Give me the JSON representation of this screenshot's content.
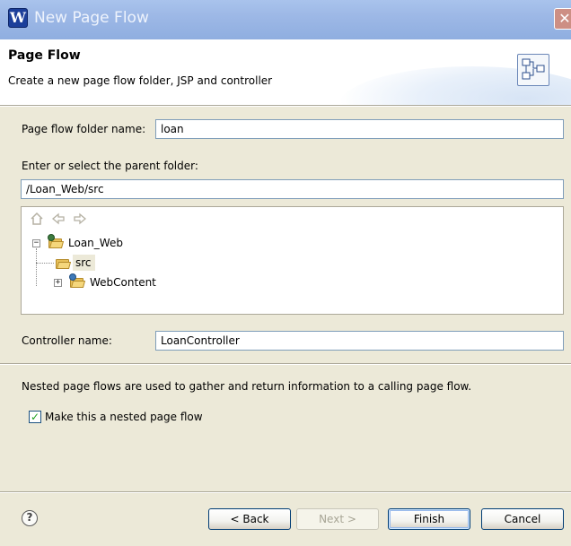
{
  "window": {
    "title": "New Page Flow",
    "app_icon_glyph": "W",
    "close_glyph": "✕"
  },
  "banner": {
    "title": "Page Flow",
    "description": "Create a new page flow folder, JSP and controller",
    "icon": "page-flow-wizard-icon"
  },
  "form": {
    "folder_name_label": "Page flow folder name:",
    "folder_name_value": "loan",
    "parent_folder_label": "Enter or select the parent folder:",
    "parent_folder_value": "/Loan_Web/src",
    "controller_label": "Controller name:",
    "controller_value": "LoanController",
    "nested_info": "Nested page flows are used to gather and return information to a calling page flow.",
    "nested_checkbox_label": "Make this a nested page flow",
    "nested_checked": true
  },
  "tree": {
    "toolbar": {
      "home_icon": "home-icon",
      "back_icon": "back-arrow-icon",
      "forward_icon": "forward-arrow-icon"
    },
    "items": [
      {
        "label": "Loan_Web",
        "expander": "−",
        "icon": "project-folder-icon"
      },
      {
        "label": "src",
        "icon": "folder-open-icon",
        "selected": true
      },
      {
        "label": "WebContent",
        "expander": "+",
        "icon": "web-folder-icon"
      }
    ]
  },
  "buttons": {
    "help_glyph": "?",
    "back": "< Back",
    "next": "Next >",
    "finish": "Finish",
    "cancel": "Cancel"
  }
}
